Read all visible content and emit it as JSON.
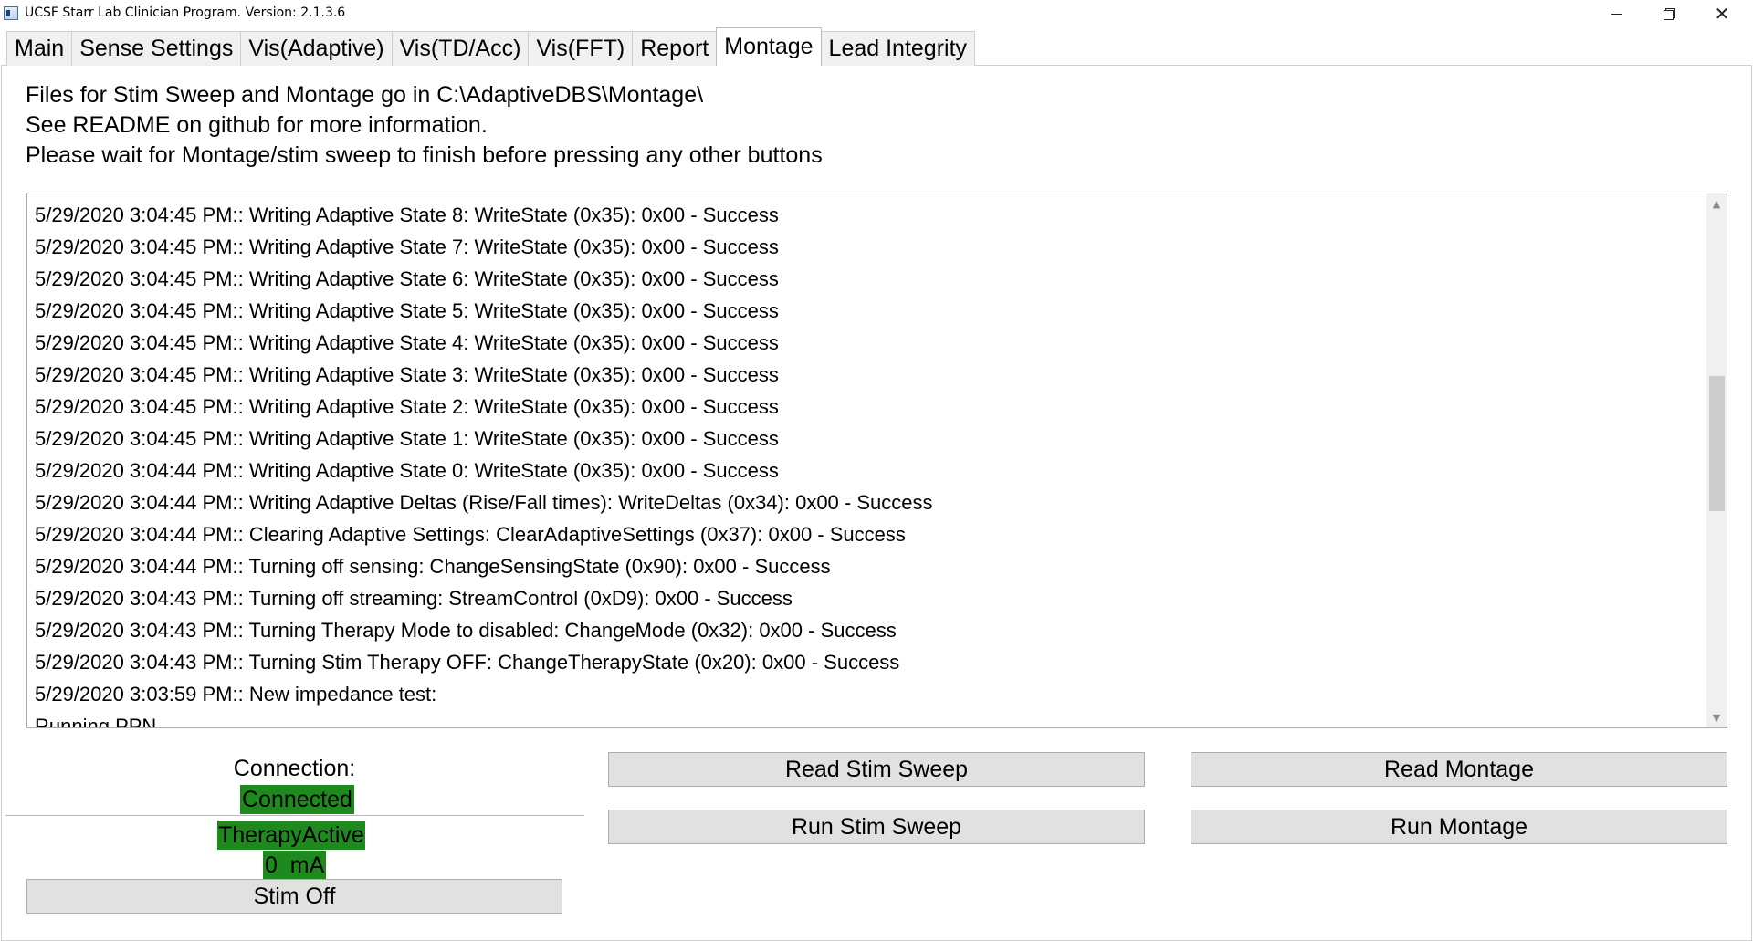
{
  "window": {
    "title": "UCSF Starr Lab Clinician Program. Version: 2.1.3.6",
    "minimize_icon": "minimize-icon",
    "maximize_icon": "restore-icon",
    "close_icon": "close-icon",
    "close_glyph": "✕"
  },
  "tabs": [
    {
      "label": "Main"
    },
    {
      "label": "Sense Settings"
    },
    {
      "label": "Vis(Adaptive)"
    },
    {
      "label": "Vis(TD/Acc)"
    },
    {
      "label": "Vis(FFT)"
    },
    {
      "label": "Report"
    },
    {
      "label": "Montage",
      "active": true
    },
    {
      "label": "Lead Integrity"
    }
  ],
  "montage": {
    "info_lines": [
      "Files for Stim Sweep and Montage go in C:\\AdaptiveDBS\\Montage\\",
      "See README on github for more information.",
      "Please wait for Montage/stim sweep to finish before pressing any other buttons"
    ],
    "log": [
      "5/29/2020 3:04:45 PM:: Writing Adaptive State 8: WriteState (0x35): 0x00 - Success",
      "5/29/2020 3:04:45 PM:: Writing Adaptive State 7: WriteState (0x35): 0x00 - Success",
      "5/29/2020 3:04:45 PM:: Writing Adaptive State 6: WriteState (0x35): 0x00 - Success",
      "5/29/2020 3:04:45 PM:: Writing Adaptive State 5: WriteState (0x35): 0x00 - Success",
      "5/29/2020 3:04:45 PM:: Writing Adaptive State 4: WriteState (0x35): 0x00 - Success",
      "5/29/2020 3:04:45 PM:: Writing Adaptive State 3: WriteState (0x35): 0x00 - Success",
      "5/29/2020 3:04:45 PM:: Writing Adaptive State 2: WriteState (0x35): 0x00 - Success",
      "5/29/2020 3:04:45 PM:: Writing Adaptive State 1: WriteState (0x35): 0x00 - Success",
      "5/29/2020 3:04:44 PM:: Writing Adaptive State 0: WriteState (0x35): 0x00 - Success",
      "5/29/2020 3:04:44 PM:: Writing Adaptive Deltas (Rise/Fall times): WriteDeltas (0x34): 0x00 - Success",
      "5/29/2020 3:04:44 PM:: Clearing Adaptive Settings: ClearAdaptiveSettings (0x37): 0x00 - Success",
      "5/29/2020 3:04:44 PM:: Turning off sensing: ChangeSensingState (0x90): 0x00 - Success",
      "5/29/2020 3:04:43 PM:: Turning off streaming: StreamControl (0xD9): 0x00 - Success",
      "5/29/2020 3:04:43 PM:: Turning Therapy Mode to disabled: ChangeMode (0x32): 0x00 - Success",
      "5/29/2020 3:04:43 PM:: Turning Stim Therapy OFF: ChangeTherapyState (0x20): 0x00 - Success",
      "5/29/2020 3:03:59 PM:: New impedance test:",
      "Running PPN"
    ],
    "buttons": {
      "read_stim_sweep": "Read Stim Sweep",
      "run_stim_sweep": "Run Stim Sweep",
      "read_montage": "Read Montage",
      "run_montage": "Run Montage"
    }
  },
  "status": {
    "connection_label": "Connection:",
    "connection_value": "Connected",
    "therapy_value": "TherapyActive",
    "amplitude_value": "0  mA",
    "stim_off_button": "Stim Off",
    "status_color": "#1e8a1e"
  },
  "scrollbar": {
    "up_glyph": "▲",
    "down_glyph": "▼"
  }
}
